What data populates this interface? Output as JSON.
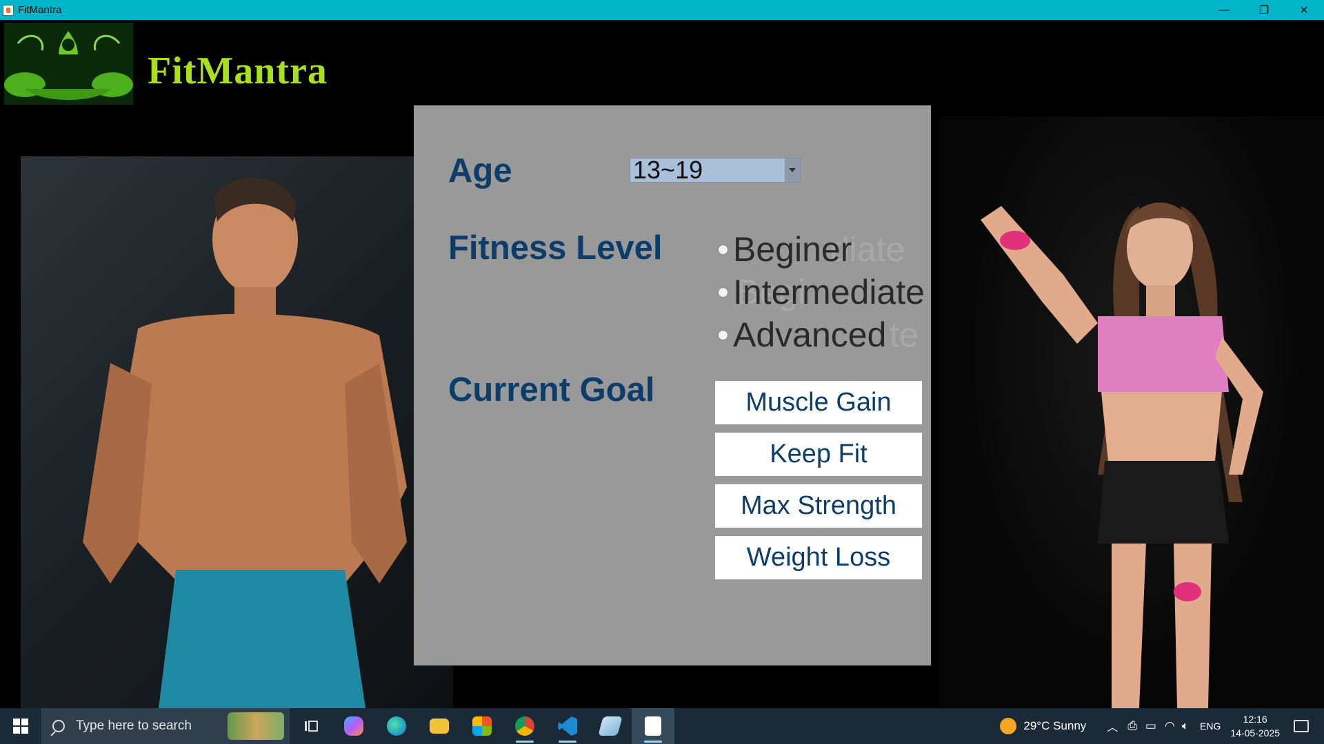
{
  "window": {
    "title": "FitMantra",
    "minimize": "—",
    "restore": "❐",
    "close": "✕"
  },
  "header": {
    "brand": "FitMantra"
  },
  "form": {
    "age_label": "Age",
    "age_value": "13~19",
    "fitness_label": "Fitness Level",
    "fitness_options": [
      "Beginer",
      "Intermediate",
      "Advanced"
    ],
    "ghost_options": [
      "diate",
      "Begi",
      "te"
    ],
    "goal_label": "Current Goal",
    "goals": [
      "Muscle Gain",
      "Keep Fit",
      "Max Strength",
      "Weight Loss"
    ]
  },
  "taskbar": {
    "search_placeholder": "Type here to search",
    "weather": "29°C  Sunny",
    "language": "ENG",
    "time": "12:16",
    "date": "14-05-2025"
  },
  "colors": {
    "brand": "#a8e01c",
    "label": "#0d3d6b",
    "titlebar": "#00b5c7",
    "panel": "#999999"
  }
}
